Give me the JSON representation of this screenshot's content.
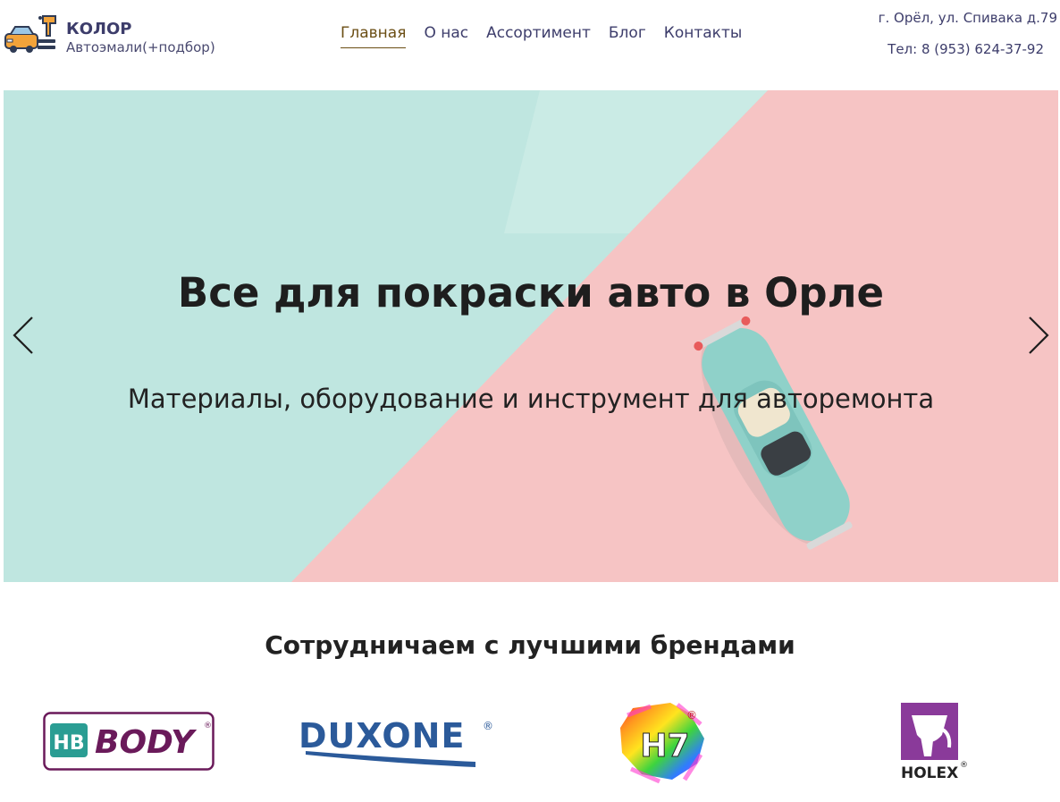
{
  "header": {
    "brand_name": "КОЛОР",
    "brand_sub": "Автоэмали(+подбор)",
    "nav": [
      {
        "label": "Главная",
        "active": true
      },
      {
        "label": "О нас",
        "active": false
      },
      {
        "label": "Ассортимент",
        "active": false
      },
      {
        "label": "Блог",
        "active": false
      },
      {
        "label": "Контакты",
        "active": false
      }
    ],
    "address": "г. Орёл, ул. Спивака д.79",
    "phone": "Тел: 8 (953) 624-37-92"
  },
  "hero": {
    "title": "Все для покраски авто в Орле",
    "subtitle": "Материалы, оборудование и инструмент для авторемонта",
    "colors": {
      "mint": "#bfe6e0",
      "pink": "#f6c4c4"
    }
  },
  "brands": {
    "title": "Сотрудничаем с лучшими брендами",
    "items": [
      {
        "name": "BODY",
        "badge": "HB",
        "icon": "body-logo"
      },
      {
        "name": "DUXONE",
        "icon": "duxone-logo"
      },
      {
        "name": "H7",
        "icon": "h7-logo"
      },
      {
        "name": "HOLEX",
        "icon": "holex-logo"
      }
    ]
  },
  "colors": {
    "nav_active": "#6b4e14",
    "nav_text": "#3d3d6b",
    "body_purple": "#6a1a5a",
    "duxone_blue": "#2b5a9a",
    "holex_purple": "#8a3a9a"
  }
}
